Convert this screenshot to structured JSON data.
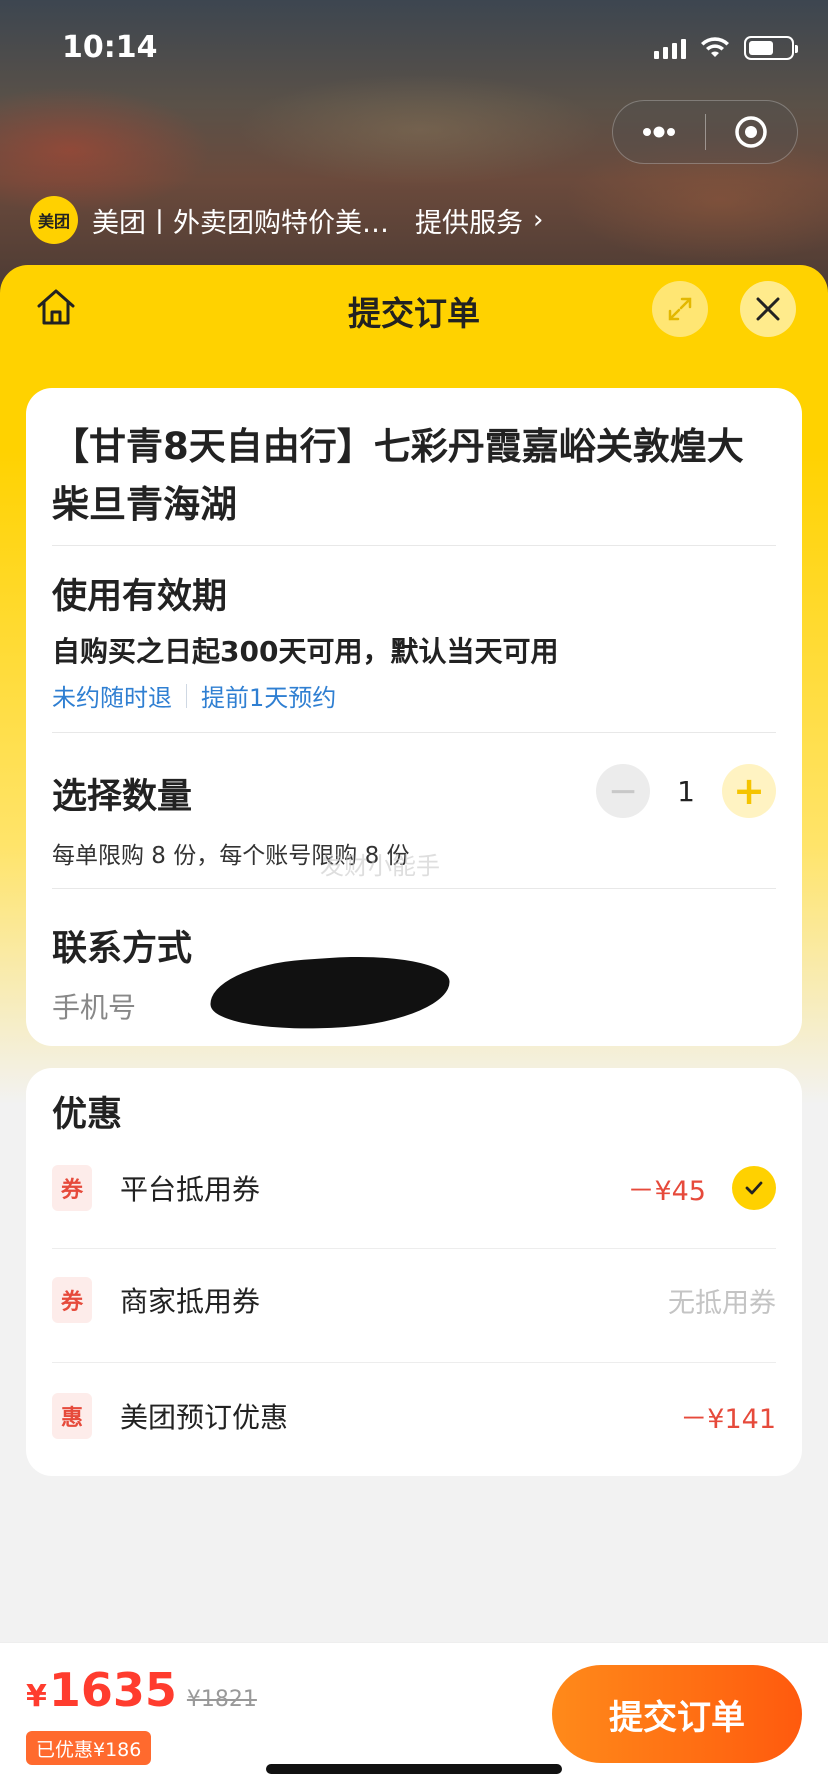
{
  "status_bar": {
    "time": "10:14"
  },
  "service_bar": {
    "logo_text": "美团",
    "name": "美团丨外卖团购特价美…",
    "provide": "提供服务",
    "chevron": "›"
  },
  "header": {
    "title": "提交订单"
  },
  "product": {
    "title": "【甘青8天自由行】七彩丹霞嘉峪关敦煌大柴旦青海湖"
  },
  "validity": {
    "heading": "使用有效期",
    "text": "自购买之日起300天可用，默认当天可用",
    "tag_refund": "未约随时退",
    "tag_booking": "提前1天预约"
  },
  "quantity": {
    "heading": "选择数量",
    "value": "1",
    "minus": "−",
    "plus": "+",
    "limit": "每单限购 8 份，每个账号限购 8 份"
  },
  "watermark": "发财小能手",
  "contact": {
    "heading": "联系方式",
    "phone_label": "手机号"
  },
  "discount": {
    "heading": "优惠",
    "rows": [
      {
        "badge": "券",
        "label": "平台抵用券",
        "value": "－¥45",
        "checked": true
      },
      {
        "badge": "券",
        "label": "商家抵用券",
        "value": "无抵用券"
      },
      {
        "badge": "惠",
        "label": "美团预订优惠",
        "value": "－¥141"
      }
    ]
  },
  "bottom": {
    "currency": "¥",
    "price": "1635",
    "original_price": "¥1821",
    "saved": "已优惠¥186",
    "submit": "提交订单"
  },
  "colors": {
    "accent_yellow": "#ffd200",
    "price_red": "#ff3c2e",
    "link_blue": "#2f7fd2",
    "submit_orange": "#ff6a1a"
  }
}
